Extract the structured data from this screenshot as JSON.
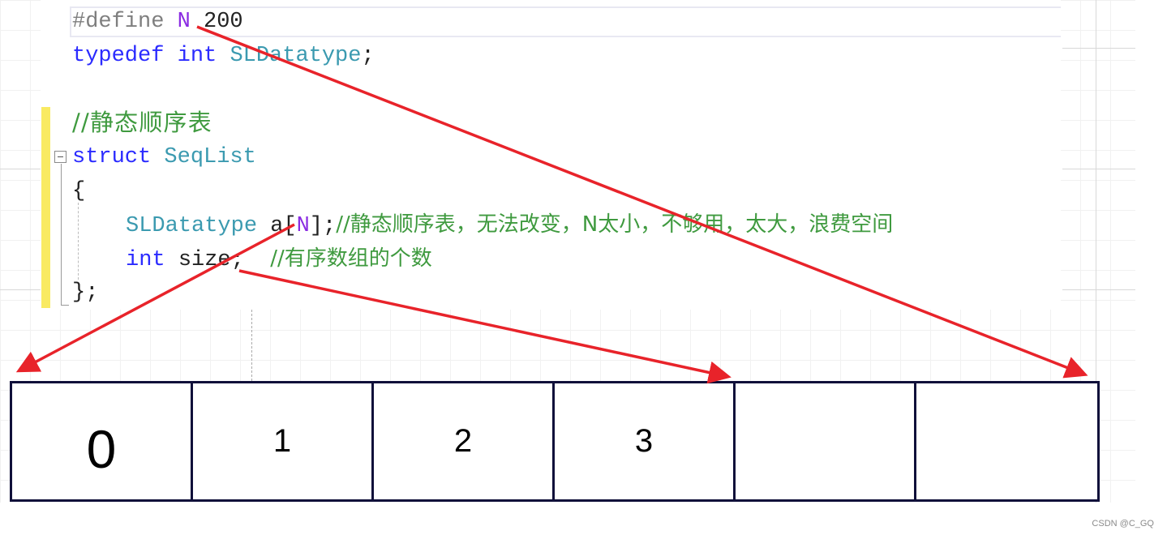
{
  "code": {
    "line1": {
      "directive": "#define",
      "macro": "N",
      "value": "200"
    },
    "line2": {
      "keyword": "typedef",
      "type_kw": "int",
      "alias": "SLDatatype",
      "end": ";"
    },
    "line3": {
      "comment": "//静态顺序表"
    },
    "line4": {
      "keyword": "struct",
      "name": "SeqList"
    },
    "line5": {
      "brace": "{"
    },
    "line6": {
      "type": "SLDatatype",
      "field": "a[",
      "macro": "N",
      "close": "];",
      "comment": "//静态顺序表，无法改变，N太小，不够用，太大，浪费空间"
    },
    "line7": {
      "type_kw": "int",
      "field": "size;",
      "comment": "//有序数组的个数"
    },
    "line8": {
      "brace": "};"
    }
  },
  "array": {
    "cells": [
      "0",
      "1",
      "2",
      "3",
      "",
      ""
    ]
  },
  "annotations": {
    "arrow_color": "#e8232a",
    "arrows": [
      {
        "from": "#define N",
        "to": "array-end"
      },
      {
        "from": "a[N]",
        "to": "array-start"
      },
      {
        "from": "size",
        "to": "after-last-element"
      }
    ]
  },
  "watermark": "CSDN @C_GQ"
}
